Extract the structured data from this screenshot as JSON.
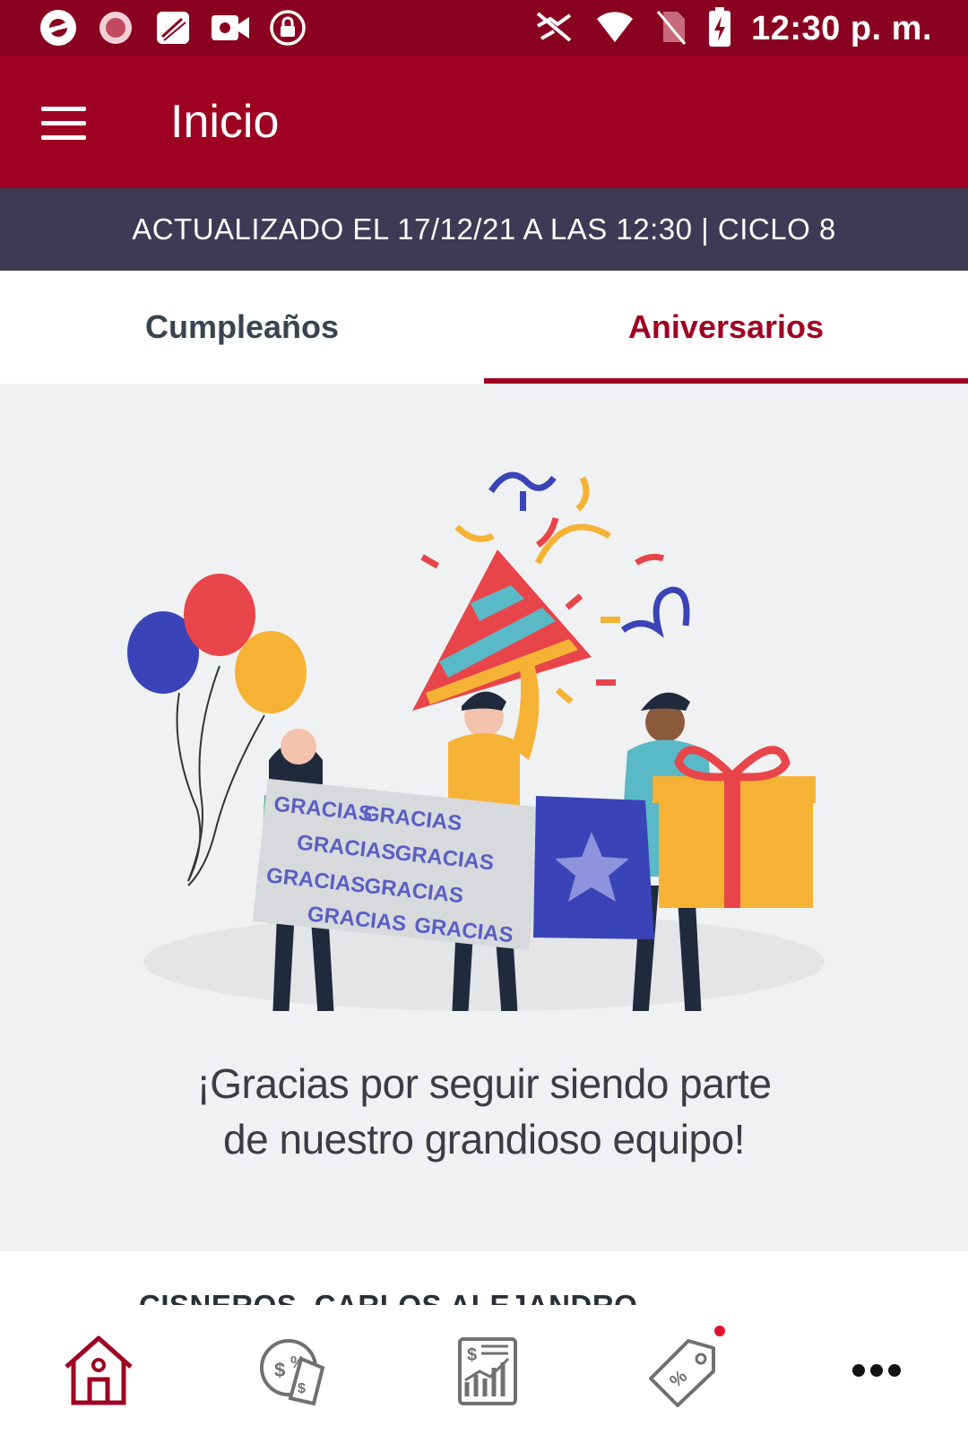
{
  "status_bar": {
    "time": "12:30 p. m.",
    "left_icons": [
      "app-icon",
      "app-icon",
      "blackberry-icon",
      "video-icon",
      "lock-icon"
    ],
    "right_icons": [
      "cast-off-icon",
      "wifi-icon",
      "no-sim-icon",
      "battery-charging-icon"
    ]
  },
  "app_bar": {
    "title": "Inicio"
  },
  "banner": {
    "text": "ACTUALIZADO EL 17/12/21 A LAS 12:30 | CICLO 8"
  },
  "tabs": [
    {
      "label": "Cumpleaños",
      "active": false
    },
    {
      "label": "Aniversarios",
      "active": true
    }
  ],
  "illustration": {
    "banner_word": "GRACIAS"
  },
  "message": {
    "line1": "¡Gracias por seguir siendo parte",
    "line2": "de nuestro grandioso equipo!"
  },
  "list": {
    "first_name": "CISNEROS, CARLOS ALEJANDRO"
  },
  "bottom_nav": [
    {
      "icon": "home-icon",
      "active": true
    },
    {
      "icon": "money-discount-icon",
      "active": false
    },
    {
      "icon": "sales-chart-icon",
      "active": false
    },
    {
      "icon": "price-tag-icon",
      "active": false,
      "notification": true
    },
    {
      "icon": "more-icon",
      "active": false
    }
  ],
  "colors": {
    "status_bar": "#8a0020",
    "app_bar": "#9e0022",
    "banner": "#3c3a55",
    "accent": "#9e0022",
    "content_bg": "#f0f1f2"
  }
}
